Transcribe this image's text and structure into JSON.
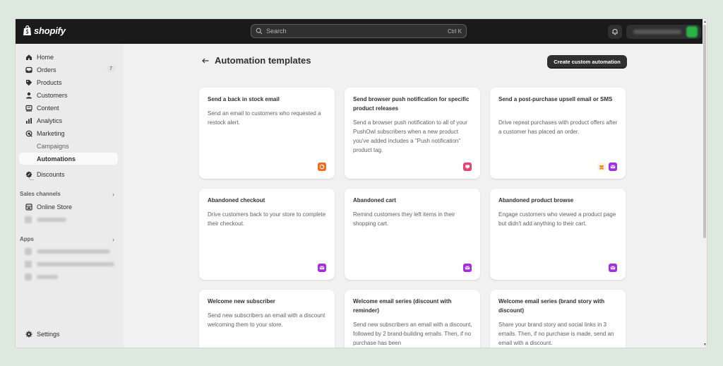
{
  "topbar": {
    "logo_text": "shopify",
    "search_placeholder": "Search",
    "search_shortcut": "Ctrl K"
  },
  "sidebar": {
    "items": [
      {
        "label": "Home",
        "icon": "home-icon"
      },
      {
        "label": "Orders",
        "icon": "orders-icon",
        "badge": "7"
      },
      {
        "label": "Products",
        "icon": "tag-icon"
      },
      {
        "label": "Customers",
        "icon": "person-icon"
      },
      {
        "label": "Content",
        "icon": "content-icon"
      },
      {
        "label": "Analytics",
        "icon": "bar-chart-icon"
      },
      {
        "label": "Marketing",
        "icon": "target-icon"
      }
    ],
    "sub_items": [
      {
        "label": "Campaigns"
      },
      {
        "label": "Automations"
      }
    ],
    "discounts_label": "Discounts",
    "sales_channels_label": "Sales channels",
    "online_store_label": "Online Store",
    "apps_label": "Apps",
    "settings_label": "Settings"
  },
  "page": {
    "title": "Automation templates",
    "create_button": "Create custom automation"
  },
  "cards": [
    {
      "title": "Send a back in stock email",
      "description": "Send an email to customers who requested a restock alert.",
      "icons": [
        "orange"
      ]
    },
    {
      "title": "Send browser push notification for specific product releases",
      "description": "Send a browser push notification to all of your PushOwl subscribers when a new product you've added includes a \"Push notification\" product tag.",
      "icons": [
        "pink"
      ]
    },
    {
      "title": "Send a post-purchase upsell email or SMS",
      "description": "Drive repeat purchases with product offers after a customer has placed an order.",
      "icons": [
        "cart",
        "purple"
      ]
    },
    {
      "title": "Abandoned checkout",
      "description": "Drive customers back to your store to complete their checkout.",
      "icons": [
        "purple"
      ]
    },
    {
      "title": "Abandoned cart",
      "description": "Remind customers they left items in their shopping cart.",
      "icons": [
        "purple"
      ]
    },
    {
      "title": "Abandoned product browse",
      "description": "Engage customers who viewed a product page but didn't add anything to their cart.",
      "icons": [
        "purple"
      ]
    },
    {
      "title": "Welcome new subscriber",
      "description": "Send new subscribers an email with a discount welcoming them to your store.",
      "icons": []
    },
    {
      "title": "Welcome email series (discount with reminder)",
      "description": "Send new subscribers an email with a discount, followed by 2 brand-building emails. Then, if no purchase has been",
      "icons": []
    },
    {
      "title": "Welcome email series (brand story with discount)",
      "description": "Share your brand story and social links in 3 emails. Then, if no purchase is made, send an email with a discount.",
      "icons": []
    }
  ],
  "colors": {
    "topbar": "#1a1a1a",
    "orange": "#f26b1d",
    "pink": "#e6436e",
    "purple": "#a52de0",
    "primary_button": "#303030"
  }
}
